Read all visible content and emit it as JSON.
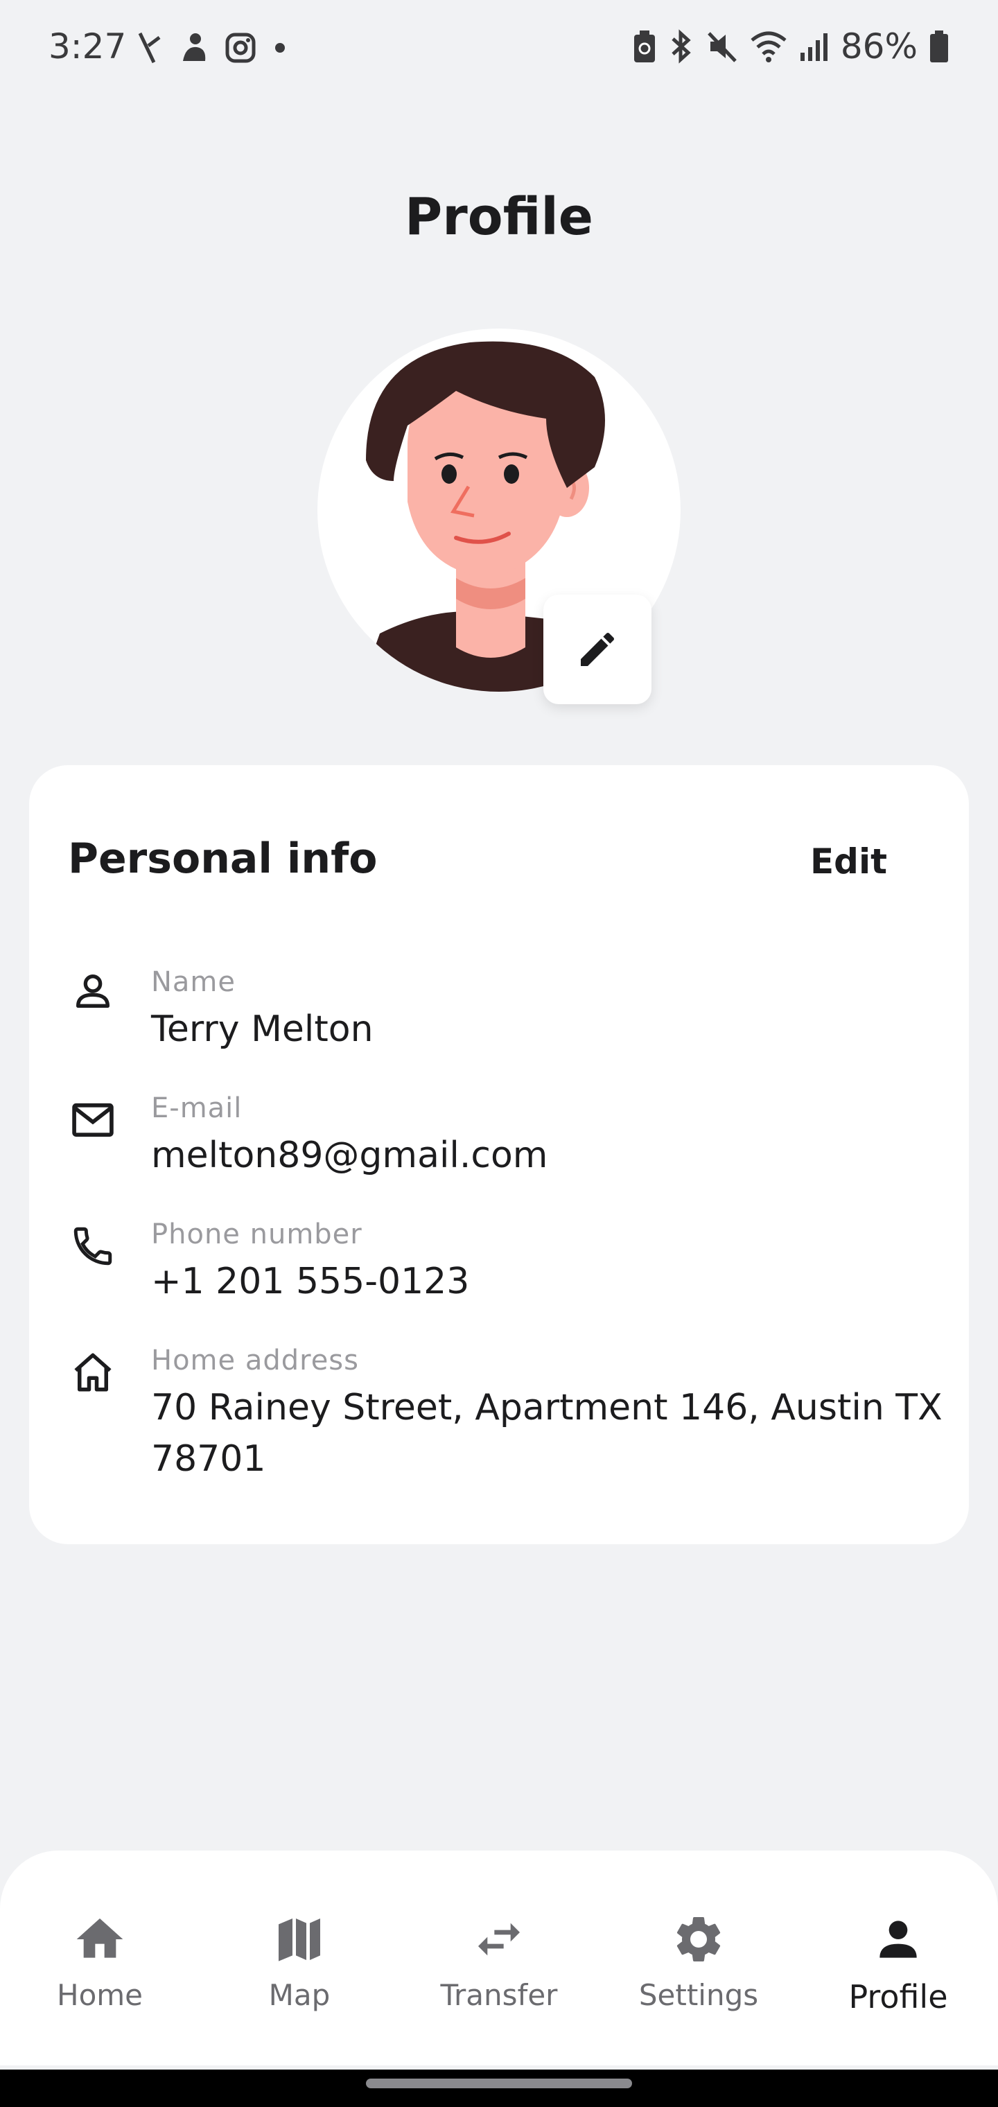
{
  "status_bar": {
    "time": "3:27",
    "battery_percent": "86%",
    "icons_left": [
      "signal-strike-icon",
      "fingerprint-icon",
      "instagram-icon",
      "dot-icon"
    ],
    "icons_right": [
      "battery-saver-icon",
      "bluetooth-icon",
      "mute-icon",
      "wifi-icon",
      "cellular-icon",
      "battery-icon"
    ]
  },
  "header": {
    "title": "Profile"
  },
  "avatar": {
    "edit_icon": "pencil-icon"
  },
  "personal_info": {
    "title": "Personal info",
    "edit_label": "Edit",
    "fields": [
      {
        "icon": "person-icon",
        "label": "Name",
        "value": "Terry Melton"
      },
      {
        "icon": "mail-icon",
        "label": "E-mail",
        "value": "melton89@gmail.com"
      },
      {
        "icon": "phone-icon",
        "label": "Phone number",
        "value": "+1 201 555-0123"
      },
      {
        "icon": "home-outline-icon",
        "label": "Home address",
        "value": "70 Rainey Street, Apartment 146, Austin TX 78701"
      }
    ]
  },
  "bottom_nav": {
    "items": [
      {
        "icon": "home-icon",
        "label": "Home",
        "active": false
      },
      {
        "icon": "map-icon",
        "label": "Map",
        "active": false
      },
      {
        "icon": "transfer-icon",
        "label": "Transfer",
        "active": false
      },
      {
        "icon": "gear-icon",
        "label": "Settings",
        "active": false
      },
      {
        "icon": "person-icon",
        "label": "Profile",
        "active": true
      }
    ]
  },
  "colors": {
    "background": "#f1f2f4",
    "card": "#ffffff",
    "text_primary": "#1c1c1e",
    "text_secondary": "#9a9a9e",
    "nav_inactive": "#6b6b6f"
  }
}
